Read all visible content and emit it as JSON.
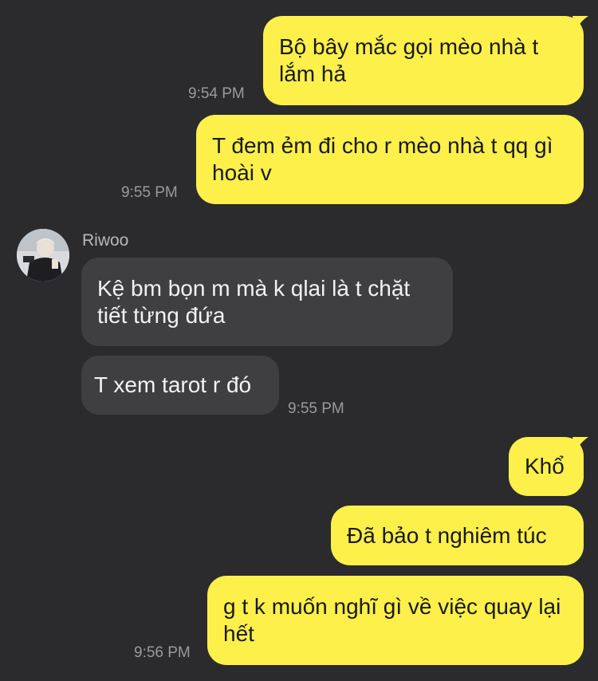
{
  "colors": {
    "background": "#2b2b2d",
    "outgoing_bubble": "#fef04a",
    "incoming_bubble": "#3f3f42",
    "timestamp": "#9a9a9e"
  },
  "messages": [
    {
      "direction": "out",
      "text": "Bộ bây mắc gọi mèo nhà t lắm hả",
      "time": "9:54 PM"
    },
    {
      "direction": "out",
      "text": "T đem ẻm đi cho r mèo nhà t qq gì hoài v",
      "time": "9:55 PM"
    },
    {
      "direction": "in",
      "sender": "Riwoo",
      "avatar": "avatar-photo",
      "text": "Kệ bm bọn m mà k qlai là t chặt tiết từng đứa"
    },
    {
      "direction": "in",
      "text": "T xem tarot r đó",
      "time": "9:55 PM"
    },
    {
      "direction": "out",
      "text": "Khổ"
    },
    {
      "direction": "out",
      "text": "Đã bảo t nghiêm túc"
    },
    {
      "direction": "out",
      "text": "g t k muốn nghĩ gì về việc quay lại hết",
      "time": "9:56 PM"
    }
  ]
}
